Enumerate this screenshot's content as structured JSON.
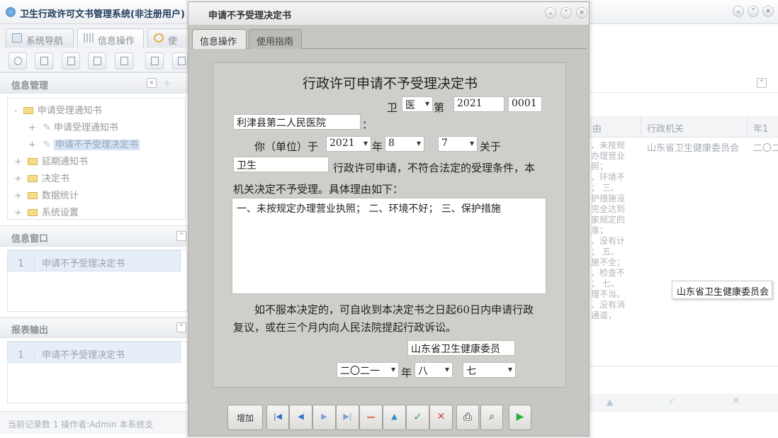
{
  "app": {
    "title": "卫生行政许可文书管理系统(非注册用户)"
  },
  "left_tabs": [
    {
      "label": "系统导航"
    },
    {
      "label": "信息操作"
    },
    {
      "label": "使用"
    }
  ],
  "info_mgmt": {
    "title": "信息管理",
    "tree": [
      {
        "label": "申请受理通知书",
        "expander": "-"
      },
      {
        "label": "申请受理通知书",
        "expander": "+"
      },
      {
        "label": "申请不予受理决定书",
        "expander": "+"
      },
      {
        "label": "延期通知书",
        "expander": "+"
      },
      {
        "label": "决定书",
        "expander": "+"
      },
      {
        "label": "数据统计",
        "expander": "+"
      },
      {
        "label": "系统设置",
        "expander": "+"
      }
    ]
  },
  "info_window": {
    "title": "信息窗口",
    "rows": [
      {
        "num": "1",
        "label": "申请不予受理决定书"
      }
    ]
  },
  "report_output": {
    "title": "报表输出",
    "rows": [
      {
        "num": "1",
        "label": "申请不予受理决定书"
      }
    ]
  },
  "status": {
    "text": "当前记录数 1      操作者:Admin      本系统支"
  },
  "right": {
    "col1": "由",
    "col2": "行政机关",
    "col3": "年1",
    "reason_lines": [
      "、未按规",
      "办理营业",
      "照；",
      "、环境不",
      "；  三、",
      "护措施没",
      "完全达到",
      "家规定的",
      "准；",
      "、没有计",
      "；  五、",
      "施不全；",
      "、检查不",
      "；  七、",
      "理不当。",
      "、没有消",
      "通道，"
    ],
    "agency": "山东省卫生健康委员会",
    "year_cell": "二〇二",
    "tooltip": "山东省卫生健康委员会"
  },
  "modal": {
    "title": "申请不予受理决定书",
    "tabs": [
      {
        "label": "信息操作"
      },
      {
        "label": "使用指南"
      }
    ],
    "form": {
      "doc_title": "行政许可申请不予受理决定书",
      "prefix_wei": "卫",
      "type_value": "医",
      "di_label": "第",
      "year_value": "2021",
      "seq_value": "0001",
      "applicant": "利津县第二人民医院",
      "colon": "：",
      "you_label": "你（单位）于",
      "app_year": "2021",
      "nian": "年",
      "app_month": "8",
      "app_day": "7",
      "guanyu": "关于",
      "item_name": "卫生",
      "sentence1": "行政许可申请，不符合法定的受理条件，本",
      "sentence2": "机关决定不予受理。具体理由如下：",
      "reasons": "一、未按规定办理营业执照；  二、环境不好；  三、保护措施",
      "notice1": "如不服本决定的，可自收到本决定书之日起60日内申请行政",
      "notice2": "复议，或在三个月内向人民法院提起行政诉讼。",
      "agency": "山东省卫生健康委员",
      "sign_year": "二〇二一",
      "sign_nian": "年",
      "sign_month": "八",
      "sign_day": "七"
    },
    "buttons": {
      "add": "增加"
    }
  },
  "colors": {
    "accent": "#3d7fc0",
    "modal_bg": "#c8c6c3",
    "selection": "#d4e3f5"
  }
}
